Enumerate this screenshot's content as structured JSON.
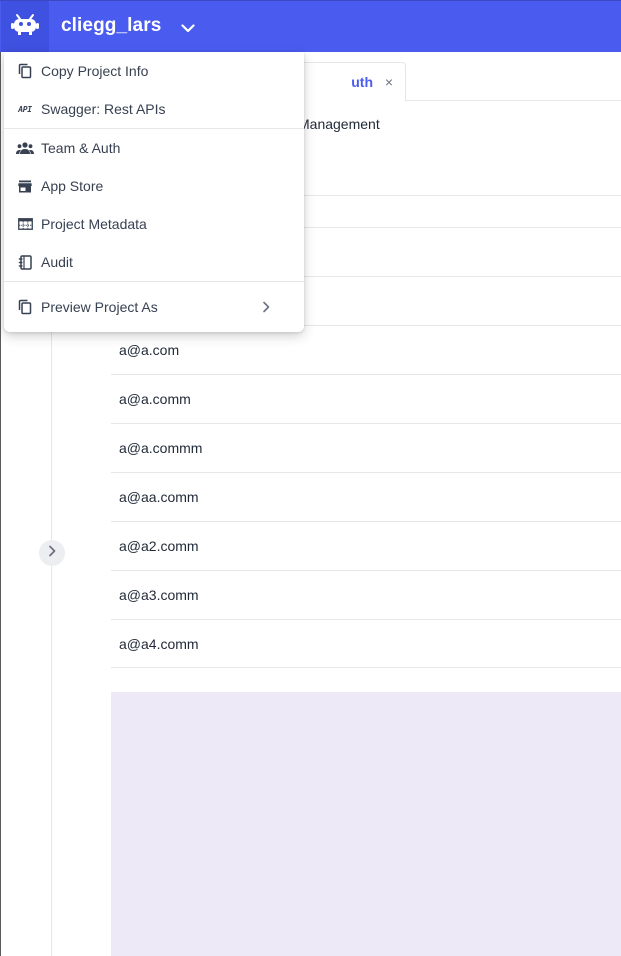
{
  "header": {
    "project_name": "cliegg_lars",
    "brand_color": "#4a5cf0",
    "logo_icon": "robot-logo-icon",
    "chevron_icon": "chevron-down-icon"
  },
  "tabs": [
    {
      "label": "uth",
      "active": true,
      "close_icon": "close-icon",
      "close_glyph": "×"
    }
  ],
  "main": {
    "section_title": "Management",
    "users": [
      "",
      "",
      "",
      "a@a.com",
      "a@a.comm",
      "a@a.commm",
      "a@aa.comm",
      "a@a2.comm",
      "a@a3.comm",
      "a@a4.comm"
    ]
  },
  "project_menu": {
    "groups": [
      {
        "items": [
          {
            "label": "Copy Project Info",
            "icon": "copy-icon"
          },
          {
            "label": "Swagger: Rest APIs",
            "icon": "api-icon",
            "icon_text": "API"
          }
        ]
      },
      {
        "items": [
          {
            "label": "Team & Auth",
            "icon": "team-icon"
          },
          {
            "label": "App Store",
            "icon": "store-icon"
          },
          {
            "label": "Project Metadata",
            "icon": "table-icon"
          },
          {
            "label": "Audit",
            "icon": "notebook-icon"
          }
        ]
      },
      {
        "items": [
          {
            "label": "Preview Project As",
            "icon": "copy-icon",
            "submenu_icon": "chevron-right-icon"
          }
        ]
      }
    ]
  },
  "sidebar": {
    "toggle_icon": "chevron-right-icon"
  },
  "colors": {
    "panel_bg": "#ede9f7",
    "accent": "#4a5cf0"
  }
}
